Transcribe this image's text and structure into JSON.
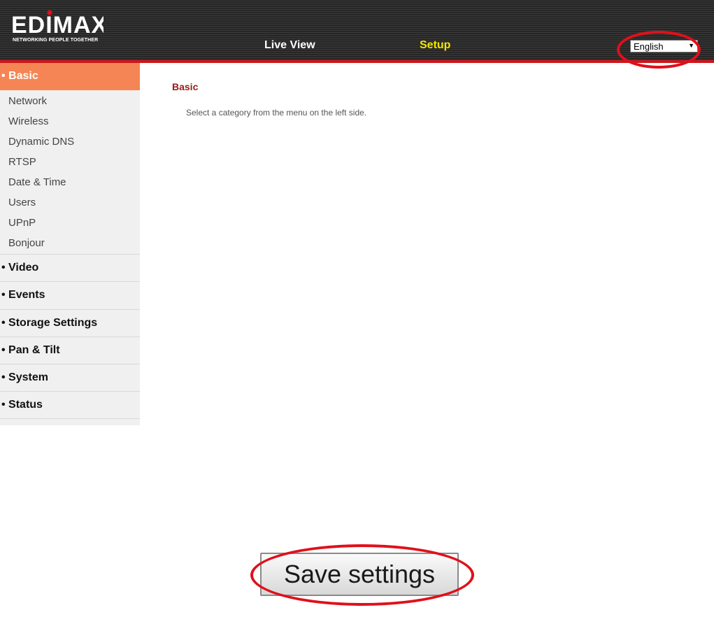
{
  "header": {
    "logo_text": "EDIMAX",
    "logo_tagline": "NETWORKING PEOPLE TOGETHER",
    "nav": {
      "live_view": "Live View",
      "setup": "Setup"
    },
    "language": {
      "selected": "English"
    }
  },
  "sidebar": {
    "basic": {
      "label": "• Basic",
      "items": [
        "Network",
        "Wireless",
        "Dynamic DNS",
        "RTSP",
        "Date & Time",
        "Users",
        "UPnP",
        "Bonjour"
      ]
    },
    "sections": [
      "• Video",
      "• Events",
      "• Storage Settings",
      "• Pan & Tilt",
      "• System",
      "• Status"
    ]
  },
  "main": {
    "title": "Basic",
    "text": "Select a category from the menu on the left side."
  },
  "footer": {
    "save_label": "Save settings"
  },
  "colors": {
    "accent_orange": "#f58554",
    "header_red_line": "#d0151b",
    "setup_yellow": "#f5e600",
    "title_red": "#9a1a1a",
    "annotation_red": "#e0101a"
  },
  "icons": {
    "dropdown": "chevron-down-icon"
  }
}
